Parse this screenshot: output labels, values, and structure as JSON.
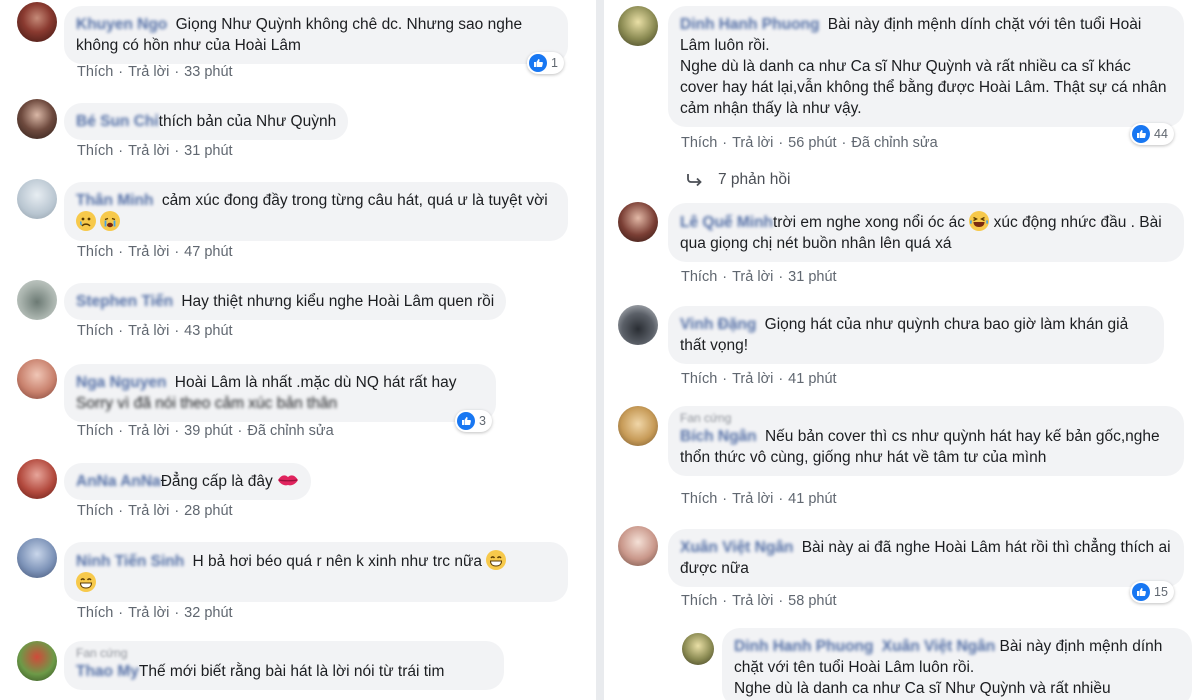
{
  "actions": {
    "like": "Thích",
    "reply": "Trả lời",
    "edited": "Đã chỉnh sửa"
  },
  "left": [
    {
      "name": "Khuyen Ngo",
      "text": "Giọng Như Quỳnh không chê dc. Nhưng sao nghe không có hồn như của Hoài Lâm",
      "time": "33 phút",
      "reactions": "1"
    },
    {
      "name": "Bé Sun Chỉ",
      "text": "thích bản của Như Quỳnh",
      "time": "31 phút"
    },
    {
      "name": "Thân Minh",
      "text": "cảm xúc đong đầy trong từng câu hát, quá ư là tuyệt vời",
      "time": "47 phút"
    },
    {
      "name": "Stephen Tiến",
      "text": "Hay thiệt nhưng kiểu nghe Hoài Lâm quen rồi",
      "time": "43 phút"
    },
    {
      "name": "Nga Nguyen",
      "text": "Hoài Lâm là nhất .mặc dù NQ hát rất hay",
      "text2": "Sorry vì đã nói theo cảm xúc bản thân",
      "time": "39 phút",
      "reactions": "3"
    },
    {
      "name": "AnNa AnNa",
      "text": "Đẳng cấp là đây",
      "time": "28 phút"
    },
    {
      "name": "Ninh Tiến Sinh",
      "text": "H bả hơi béo quá r nên k xinh như trc nữa",
      "time": "32 phút"
    },
    {
      "fan": "Fan cứng",
      "name": "Thao My",
      "text": "Thế mới biết rằng bài hát là lời nói từ trái tim"
    }
  ],
  "right": [
    {
      "name": "Dinh Hanh Phuong",
      "text": "Bài này định mệnh dính chặt với tên tuổi Hoài Lâm luôn rồi.",
      "text2": "Nghe dù là danh ca như Ca sĩ Như Quỳnh và rất nhiều ca sĩ khác cover hay hát lại,vẫn không thể bằng được Hoài Lâm. Thật sự cá nhân cảm nhận thấy là như vậy.",
      "time": "56 phút",
      "reactions": "44",
      "replies": "7 phản hồi"
    },
    {
      "name": "Lê Quế Minh",
      "text": "trời em nghe xong nổi óc ác",
      "text_b": "xúc động nhức đầu . Bài qua giọng chị nét buồn nhân lên quá xá",
      "time": "31 phút"
    },
    {
      "name": "Vinh Đặng",
      "text": "Giọng hát của như quỳnh chưa bao giờ làm khán giả thất vọng!",
      "time": "41 phút"
    },
    {
      "fan": "Fan cứng",
      "name": "Bích Ngân",
      "text": "Nếu bản cover thì cs như quỳnh hát hay kế bản gốc,nghe thổn thức vô cùng, giống như hát về tâm tư của mình",
      "time": "41 phút"
    },
    {
      "name": "Xuân Việt Ngân",
      "text": "Bài này ai đã nghe Hoài Lâm hát rồi thì chẳng thích ai được nữa",
      "time": "58 phút",
      "reactions": "15"
    },
    {
      "name": "Dinh Hanh Phuong",
      "tag": "Xuân Việt Ngân",
      "text": "Bài này định mệnh dính chặt với tên tuổi Hoài Lâm luôn rồi.",
      "text2": "Nghe dù là danh ca như Ca sĩ Như Quỳnh và rất nhiều"
    }
  ],
  "colors": {
    "name": "#385898",
    "bubble": "#f2f3f5",
    "like": "#1877f2",
    "meta": "#606770"
  }
}
